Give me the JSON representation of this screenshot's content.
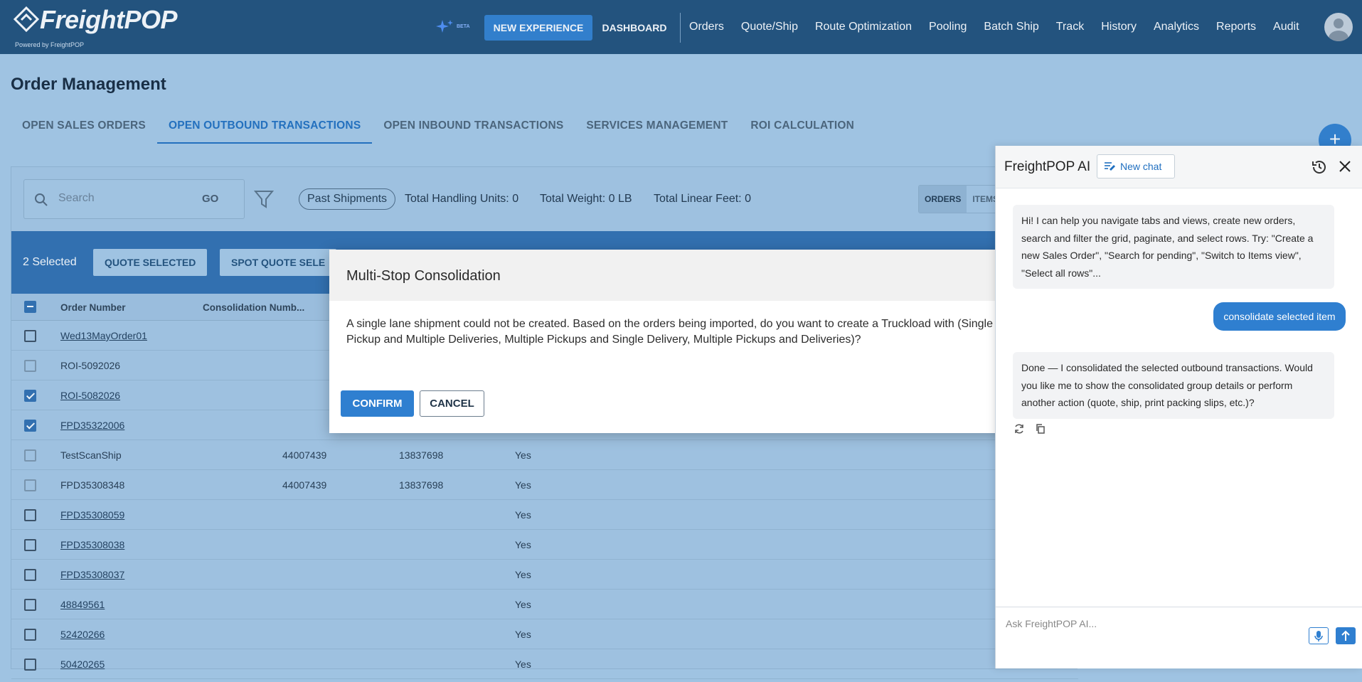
{
  "app": {
    "brand": "FreightPOP",
    "powered_by": "Powered by  FreightPOP"
  },
  "topnav": {
    "beta_label": "BETA",
    "new_experience": "NEW EXPERIENCE",
    "dashboard": "DASHBOARD",
    "links": [
      "Orders",
      "Quote/Ship",
      "Route Optimization",
      "Pooling",
      "Batch Ship",
      "Track",
      "History",
      "Analytics",
      "Reports",
      "Audit"
    ]
  },
  "page": {
    "title": "Order Management"
  },
  "tabs": [
    "OPEN SALES ORDERS",
    "OPEN OUTBOUND TRANSACTIONS",
    "OPEN INBOUND TRANSACTIONS",
    "SERVICES MANAGEMENT",
    "ROI CALCULATION"
  ],
  "toolbar": {
    "search_placeholder": "Search",
    "go": "GO",
    "chip": "Past Shipments",
    "total_handling": "Total Handling Units: 0",
    "total_weight": "Total Weight: 0 LB",
    "total_linear": "Total Linear Feet: 0",
    "view_orders": "ORDERS",
    "view_items": "ITEMS"
  },
  "selection": {
    "count": "2 Selected",
    "quote": "QUOTE SELECTED",
    "spot_quote": "SPOT QUOTE SELE"
  },
  "grid": {
    "headers": [
      "Order Number",
      "Consolidation Numb..."
    ],
    "rows": [
      {
        "order": "Wed13MayOrder01",
        "c2": "",
        "c3": "",
        "c4": "",
        "state": "empty",
        "link": true
      },
      {
        "order": "ROI-5092026",
        "c2": "",
        "c3": "",
        "c4": "",
        "state": "light",
        "link": false
      },
      {
        "order": "ROI-5082026",
        "c2": "",
        "c3": "",
        "c4": "",
        "state": "checked",
        "link": true
      },
      {
        "order": "FPD35322006",
        "c2": "",
        "c3": "",
        "c4": "",
        "state": "checked",
        "link": true
      },
      {
        "order": "TestScanShip",
        "c2": "44007439",
        "c3": "13837698",
        "c4": "Yes",
        "state": "light",
        "link": false
      },
      {
        "order": "FPD35308348",
        "c2": "44007439",
        "c3": "13837698",
        "c4": "Yes",
        "state": "light",
        "link": false
      },
      {
        "order": "FPD35308059",
        "c2": "",
        "c3": "",
        "c4": "Yes",
        "state": "empty",
        "link": true
      },
      {
        "order": "FPD35308038",
        "c2": "",
        "c3": "",
        "c4": "Yes",
        "state": "empty",
        "link": true
      },
      {
        "order": "FPD35308037",
        "c2": "",
        "c3": "",
        "c4": "Yes",
        "state": "empty",
        "link": true
      },
      {
        "order": "48849561",
        "c2": "",
        "c3": "",
        "c4": "Yes",
        "state": "empty",
        "link": true
      },
      {
        "order": "52420266",
        "c2": "",
        "c3": "",
        "c4": "Yes",
        "state": "empty",
        "link": true
      },
      {
        "order": "50420265",
        "c2": "",
        "c3": "",
        "c4": "Yes",
        "state": "empty",
        "link": true
      }
    ]
  },
  "modal": {
    "title": "Multi-Stop Consolidation",
    "body_line1": "A single lane shipment could not be created. Based on the orders being imported, do you want to create a Truckload with (Single",
    "body_line2": "Pickup and Multiple Deliveries, Multiple Pickups and Single Delivery, Multiple Pickups and Deliveries)?",
    "confirm": "CONFIRM",
    "cancel": "CANCEL"
  },
  "ai": {
    "title": "FreightPOP AI",
    "new_chat": "New chat",
    "greeting": "Hi! I can help you navigate tabs and views, create new orders, search and filter the grid, paginate, and select rows. Try: \"Create a new Sales Order\", \"Search for pending\", \"Switch to Items view\", \"Select all rows\"...",
    "user_msg": "consolidate selected item",
    "reply": "Done — I consolidated the selected outbound transactions. Would you like me to show the consolidated group details or perform another action (quote, ship, print packing slips, etc.)?",
    "input_placeholder": "Ask FreightPOP AI..."
  }
}
